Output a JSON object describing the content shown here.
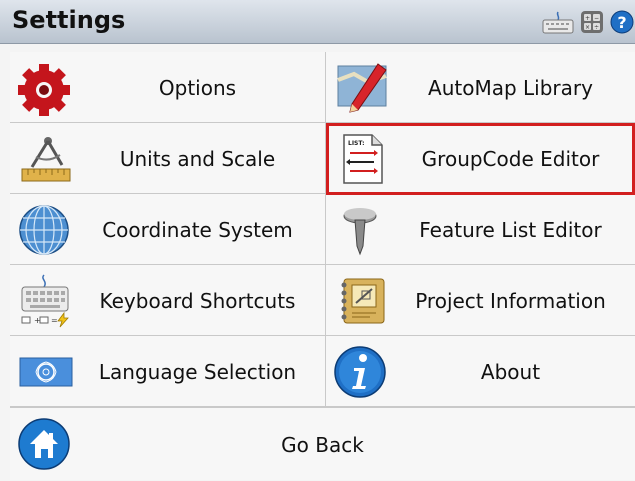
{
  "header": {
    "title": "Settings",
    "icons": [
      "keyboard-icon",
      "calculator-icon",
      "help-icon"
    ]
  },
  "menu": {
    "items": [
      {
        "label": "Options",
        "icon": "gear-icon"
      },
      {
        "label": "AutoMap Library",
        "icon": "map-pencil-icon"
      },
      {
        "label": "Units and Scale",
        "icon": "compass-ruler-icon"
      },
      {
        "label": "GroupCode Editor",
        "icon": "list-document-icon",
        "highlighted": true
      },
      {
        "label": "Coordinate System",
        "icon": "globe-icon"
      },
      {
        "label": "Feature List Editor",
        "icon": "survey-pin-icon"
      },
      {
        "label": "Keyboard Shortcuts",
        "icon": "keyboard-shortcuts-icon"
      },
      {
        "label": "Project Information",
        "icon": "notebook-icon"
      },
      {
        "label": "Language Selection",
        "icon": "un-flag-icon"
      },
      {
        "label": "About",
        "icon": "info-icon"
      }
    ],
    "go_back": {
      "label": "Go Back",
      "icon": "home-icon"
    }
  },
  "colors": {
    "highlight": "#d21f1f",
    "title_bar": "#c8d0da"
  }
}
